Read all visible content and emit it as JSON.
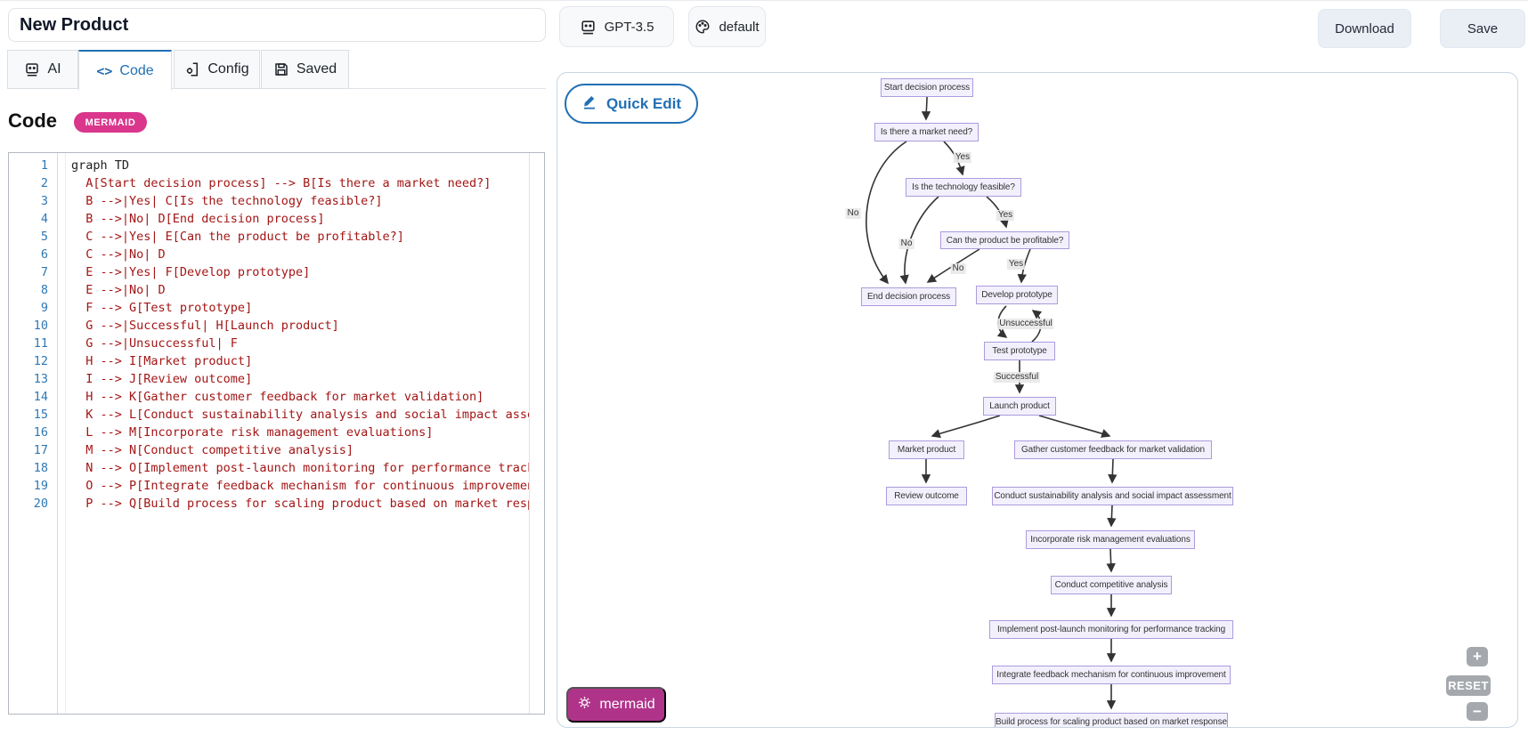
{
  "header": {
    "title_value": "New Product",
    "model_button": "GPT-3.5",
    "theme_button": "default",
    "download_button": "Download",
    "save_button": "Save"
  },
  "tabs": {
    "items": [
      {
        "label": "AI",
        "icon": "robot-icon",
        "active": false
      },
      {
        "label": "Code",
        "icon": "code-icon",
        "active": true
      },
      {
        "label": "Config",
        "icon": "config-icon",
        "active": false
      },
      {
        "label": "Saved",
        "icon": "save-icon",
        "active": false
      }
    ]
  },
  "editor": {
    "heading": "Code",
    "badge": "MERMAID",
    "lines": [
      "graph TD",
      "  A[Start decision process] --> B[Is there a market need?]",
      "  B -->|Yes| C[Is the technology feasible?]",
      "  B -->|No| D[End decision process]",
      "  C -->|Yes| E[Can the product be profitable?]",
      "  C -->|No| D",
      "  E -->|Yes| F[Develop prototype]",
      "  E -->|No| D",
      "  F --> G[Test prototype]",
      "  G -->|Successful| H[Launch product]",
      "  G -->|Unsuccessful| F",
      "  H --> I[Market product]",
      "  I --> J[Review outcome]",
      "  H --> K[Gather customer feedback for market validation]",
      "  K --> L[Conduct sustainability analysis and social impact assessment]",
      "  L --> M[Incorporate risk management evaluations]",
      "  M --> N[Conduct competitive analysis]",
      "  N --> O[Implement post-launch monitoring for performance tracking]",
      "  O --> P[Integrate feedback mechanism for continuous improvement]",
      "  P --> Q[Build process for scaling product based on market response]"
    ]
  },
  "canvas": {
    "quick_edit_button": "Quick Edit",
    "engine_badge": "mermaid",
    "zoom_in": "+",
    "zoom_reset": "RESET",
    "zoom_out": "−"
  },
  "diagram": {
    "nodes": [
      {
        "id": "A",
        "label": "Start decision process"
      },
      {
        "id": "B",
        "label": "Is there a market need?"
      },
      {
        "id": "C",
        "label": "Is the technology feasible?"
      },
      {
        "id": "E",
        "label": "Can the product be profitable?"
      },
      {
        "id": "D",
        "label": "End decision process"
      },
      {
        "id": "F",
        "label": "Develop prototype"
      },
      {
        "id": "G",
        "label": "Test prototype"
      },
      {
        "id": "H",
        "label": "Launch product"
      },
      {
        "id": "I",
        "label": "Market product"
      },
      {
        "id": "K",
        "label": "Gather customer feedback for market validation"
      },
      {
        "id": "J",
        "label": "Review outcome"
      },
      {
        "id": "L",
        "label": "Conduct sustainability analysis and social impact assessment"
      },
      {
        "id": "M",
        "label": "Incorporate risk management evaluations"
      },
      {
        "id": "N",
        "label": "Conduct competitive analysis"
      },
      {
        "id": "O",
        "label": "Implement post-launch monitoring for performance tracking"
      },
      {
        "id": "P",
        "label": "Integrate feedback mechanism for continuous improvement"
      },
      {
        "id": "Q",
        "label": "Build process for scaling product based on market response"
      }
    ],
    "edge_labels": [
      {
        "text": "Yes"
      },
      {
        "text": "No"
      },
      {
        "text": "Yes"
      },
      {
        "text": "No"
      },
      {
        "text": "Yes"
      },
      {
        "text": "No"
      },
      {
        "text": "Unsuccessful"
      },
      {
        "text": "Successful"
      }
    ]
  },
  "colors": {
    "accent_blue": "#2270b4",
    "badge_pink": "#d9368c",
    "engine_magenta": "#b0338a",
    "node_fill": "#f3f0fd",
    "node_border": "#ac9bdc",
    "code_red": "#a31515",
    "line_number_blue": "#2e78b5"
  }
}
